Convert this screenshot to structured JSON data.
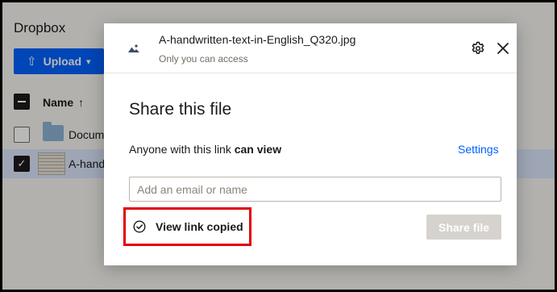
{
  "app": {
    "title": "Dropbox",
    "upload_label": "Upload",
    "accent_color": "#0061fe"
  },
  "file_list": {
    "column_name": "Name",
    "sort_arrow": "↑",
    "rows": [
      {
        "label": "Docum",
        "icon": "folder-icon",
        "checked": false
      },
      {
        "label": "A-hand",
        "icon": "image-thumbnail",
        "checked": true
      }
    ]
  },
  "modal": {
    "file_name": "A-handwritten-text-in-English_Q320.jpg",
    "access_text": "Only you can access",
    "title": "Share this file",
    "permission_prefix": "Anyone with this link ",
    "permission_value": "can view",
    "settings_label": "Settings",
    "email_placeholder": "Add an email or name",
    "email_value": "",
    "copied_label": "View link copied",
    "share_button_label": "Share file",
    "highlight_color": "#e0000a"
  }
}
